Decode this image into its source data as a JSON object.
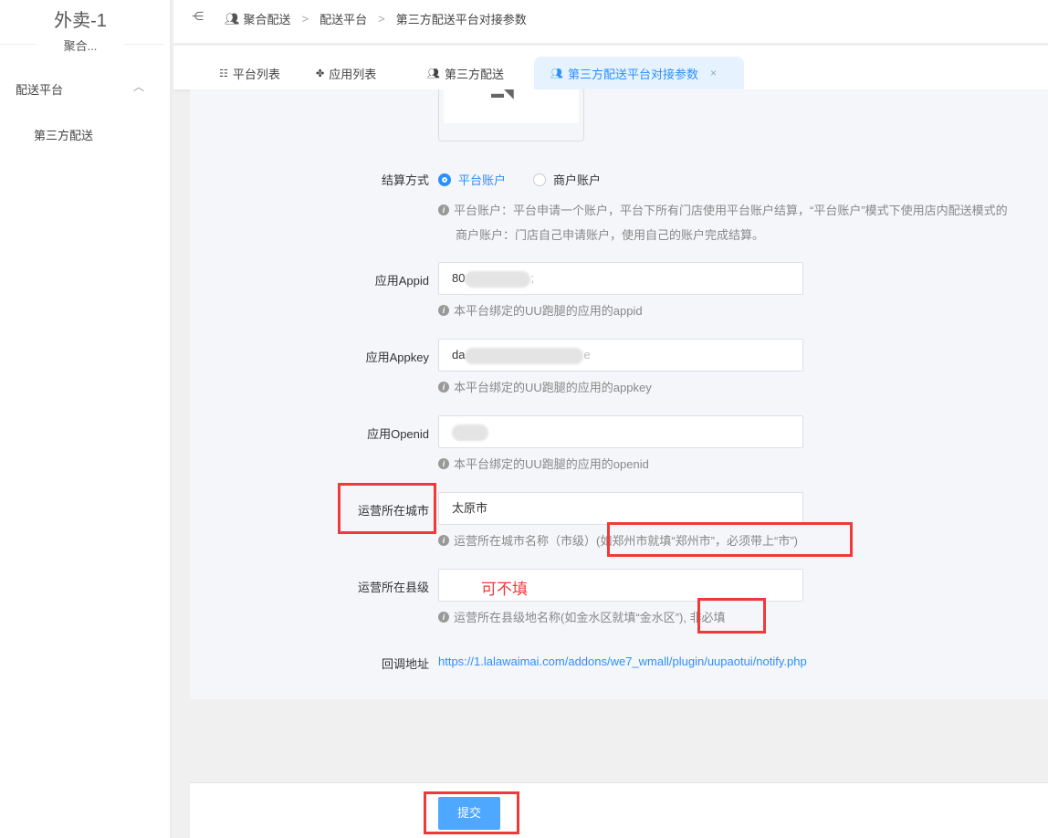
{
  "sidebar": {
    "brand": "外卖-1",
    "brand_sub": "聚合...",
    "menu_group": "配送平台",
    "menu_item": "第三方配送"
  },
  "breadcrumb": [
    "聚合配送",
    "配送平台",
    "第三方配送平台对接参数"
  ],
  "tabs": [
    {
      "label": "平台列表",
      "icon": "list-icon"
    },
    {
      "label": "应用列表",
      "icon": "grid-icon"
    },
    {
      "label": "第三方配送",
      "icon": "users-icon"
    },
    {
      "label": "第三方配送平台对接参数",
      "icon": "users-icon",
      "active": true,
      "close": "×"
    }
  ],
  "form": {
    "settlement": {
      "label": "结算方式",
      "options": [
        "平台账户",
        "商户账户"
      ],
      "selected": "平台账户",
      "help1": "平台账户：平台申请一个账户，平台下所有门店使用平台账户结算，“平台账户”模式下使用店内配送模式的",
      "help2": "商户账户：门店自己申请账户，使用自己的账户完成结算。"
    },
    "appid": {
      "label": "应用Appid",
      "value_start": "80",
      "value_end": ";",
      "help": "本平台绑定的UU跑腿的应用的appid"
    },
    "appkey": {
      "label": "应用Appkey",
      "value_start": "da",
      "value_end": "e",
      "help": "本平台绑定的UU跑腿的应用的appkey"
    },
    "openid": {
      "label": "应用Openid",
      "help": "本平台绑定的UU跑腿的应用的openid"
    },
    "city": {
      "label": "运营所在城市",
      "value": "太原市",
      "help_a": "运营所在城市名称（市级）",
      "help_b": "(如郑州市就填“郑州市”，必须带上“市”)"
    },
    "county": {
      "label": "运营所在县级",
      "value": "",
      "annotation": "可不填",
      "help_a": "运营所在县级地名称(如金水区就填“金水区”)",
      "help_b": ", 非必填"
    },
    "callback": {
      "label": "回调地址",
      "url": "https://1.lalawaimai.com/addons/we7_wmall/plugin/uupaotui/notify.php"
    }
  },
  "submit_label": "提交",
  "colors": {
    "primary": "#2b8fff",
    "button": "#4ea8ff",
    "annotation": "#f03a3a"
  }
}
